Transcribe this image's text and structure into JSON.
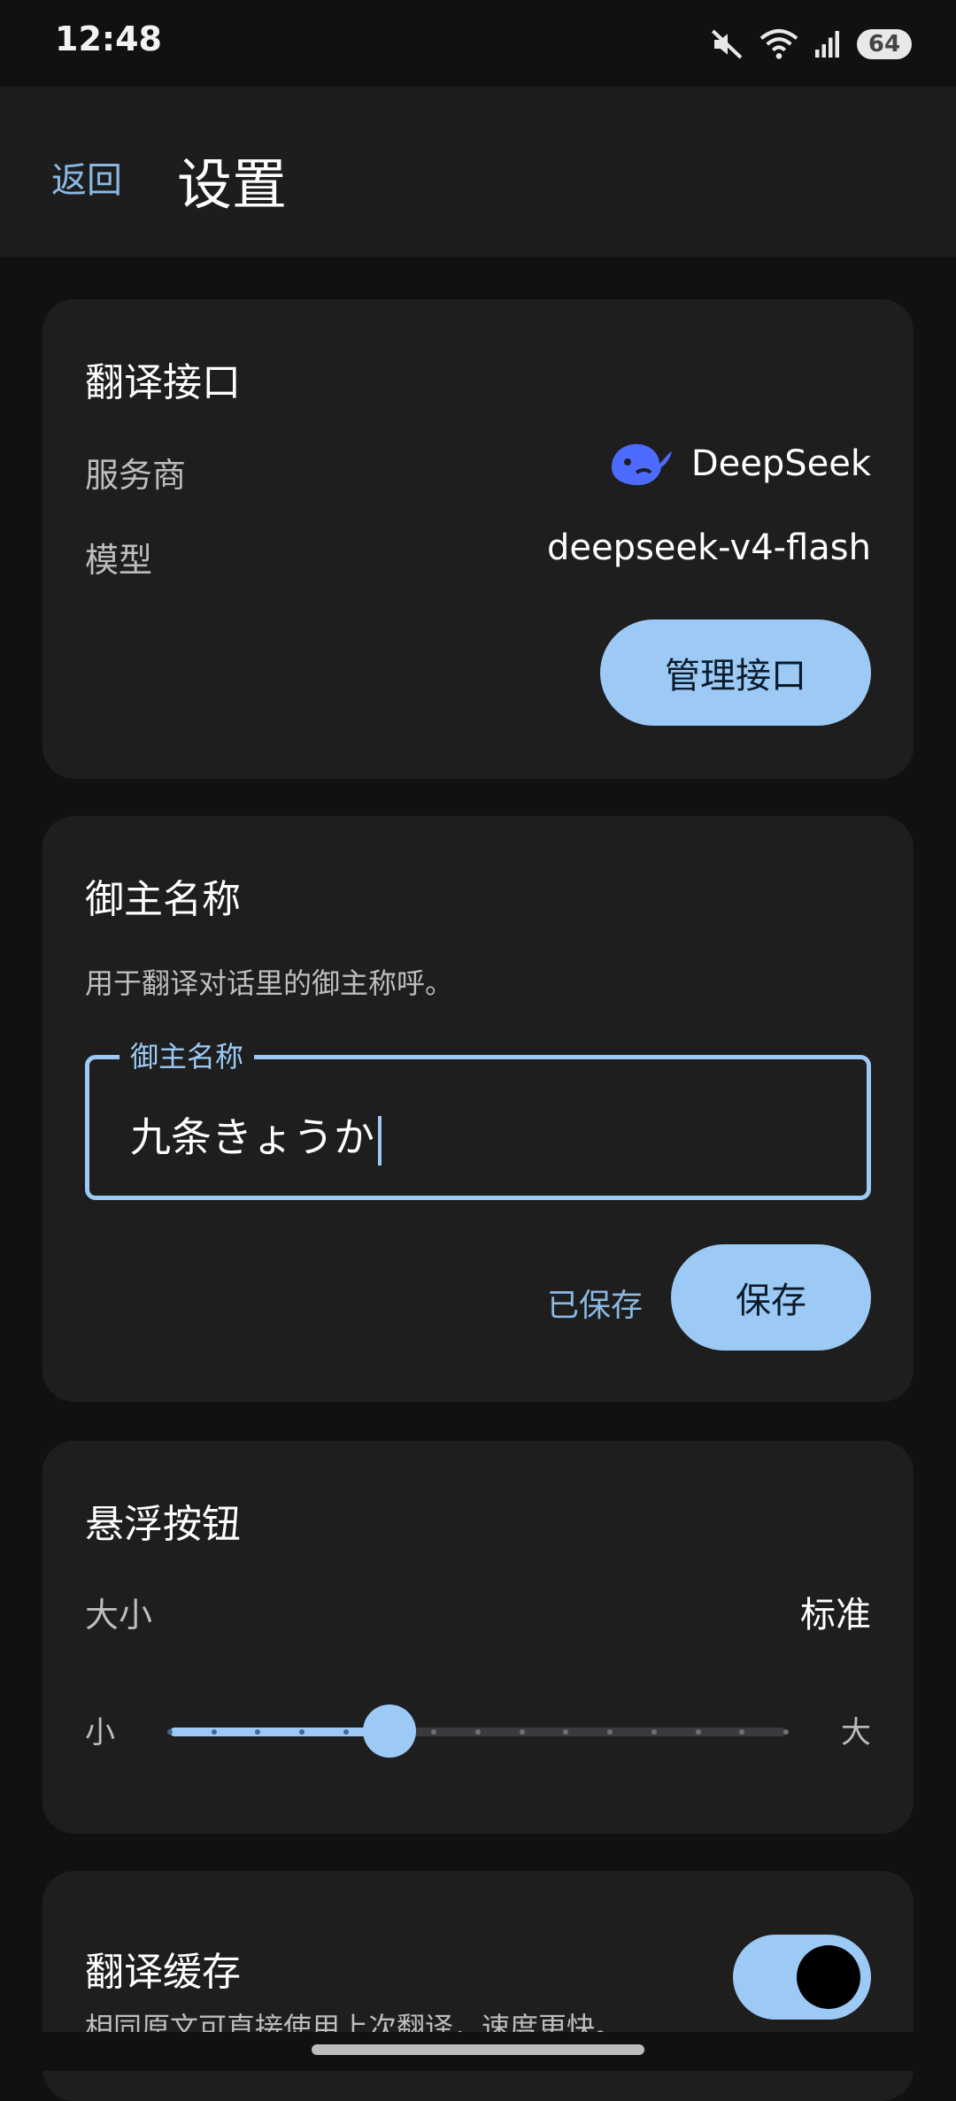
{
  "status": {
    "time": "12:48",
    "battery": "64",
    "icons": [
      "mute-icon",
      "wifi-icon",
      "signal-icon",
      "battery-icon"
    ]
  },
  "header": {
    "back_label": "返回",
    "title": "设置"
  },
  "translate_api": {
    "title": "翻译接口",
    "provider_label": "服务商",
    "provider_value": "DeepSeek",
    "provider_icon": "deepseek-whale-icon",
    "model_label": "模型",
    "model_value": "deepseek-v4-flash",
    "manage_button": "管理接口"
  },
  "master_name": {
    "title": "御主名称",
    "description": "用于翻译对话里的御主称呼。",
    "field_label": "御主名称",
    "field_value": "九条きょうか",
    "saved_status": "已保存",
    "save_button": "保存"
  },
  "floating_button": {
    "title": "悬浮按钮",
    "size_label": "大小",
    "size_value": "标准",
    "min_label": "小",
    "max_label": "大",
    "slider_level_fraction": 0.357
  },
  "translation_cache": {
    "title": "翻译缓存",
    "description": "相同原文可直接使用上次翻译，速度更快。",
    "enabled": true
  },
  "colors": {
    "accent": "#9ccaf5",
    "background": "#111111",
    "card": "#1e1e1e",
    "deepseek_blue": "#4d6bfe"
  }
}
